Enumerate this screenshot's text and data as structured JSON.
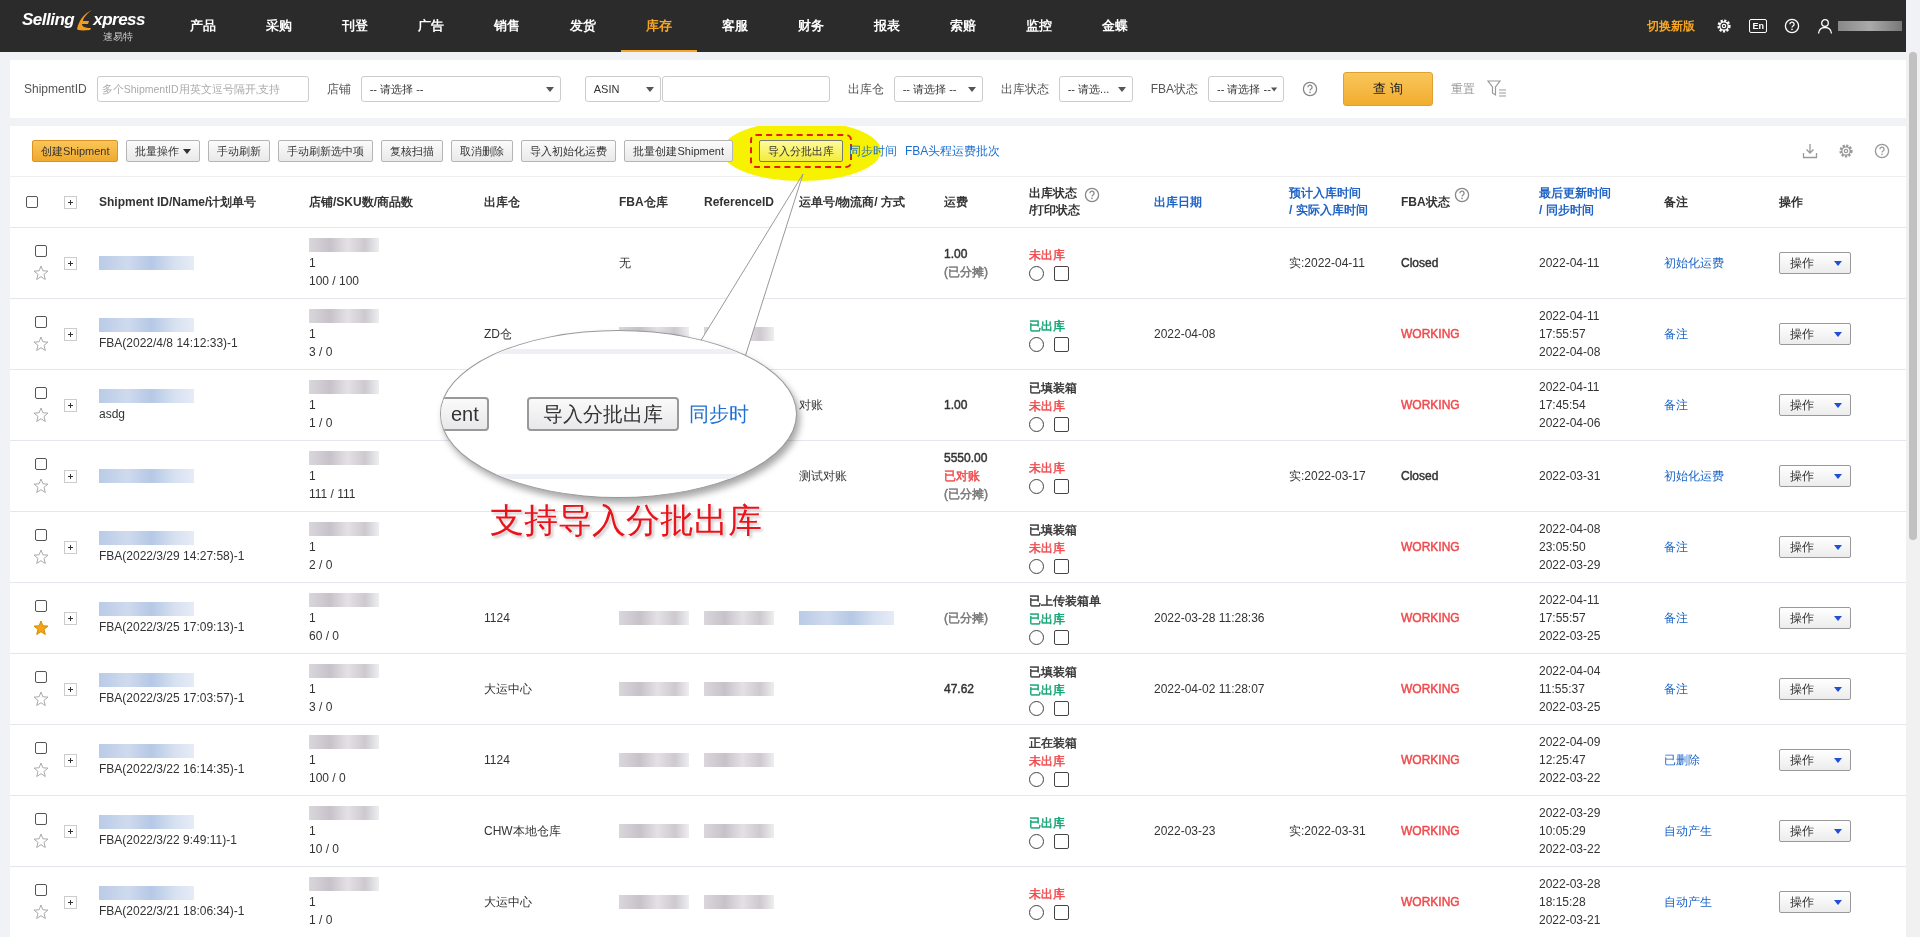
{
  "nav": {
    "logo": {
      "word1": "Selling",
      "word2": "xpress",
      "sub": "速易特"
    },
    "items": [
      {
        "label": "产品",
        "selected": false
      },
      {
        "label": "采购",
        "selected": false
      },
      {
        "label": "刊登",
        "selected": false
      },
      {
        "label": "广告",
        "selected": false
      },
      {
        "label": "销售",
        "selected": false
      },
      {
        "label": "发货",
        "selected": false
      },
      {
        "label": "库存",
        "selected": true
      },
      {
        "label": "客服",
        "selected": false
      },
      {
        "label": "财务",
        "selected": false
      },
      {
        "label": "报表",
        "selected": false
      },
      {
        "label": "索赔",
        "selected": false
      },
      {
        "label": "监控",
        "selected": false
      },
      {
        "label": "金蝶",
        "selected": false
      }
    ],
    "switch_link": "切换新版",
    "lang_button": "En"
  },
  "filters": {
    "shipment": {
      "label": "ShipmentID",
      "placeholder": "多个ShipmentID用英文逗号隔开,支持"
    },
    "shop": {
      "label": "店铺",
      "value": "-- 请选择 --"
    },
    "asin": {
      "value": "ASIN"
    },
    "warehouse": {
      "label": "出库仓",
      "value": "-- 请选择 --"
    },
    "out_status": {
      "label": "出库状态",
      "value": "-- 请选..."
    },
    "fba_status": {
      "label": "FBA状态",
      "value": "-- 请选择 --"
    },
    "search_button": "查 询",
    "reset_link": "重置"
  },
  "toolbar": {
    "buttons": [
      {
        "label": "创建Shipment",
        "kind": "primary",
        "highlighted": false
      },
      {
        "label": "批量操作",
        "kind": "dropdown",
        "highlighted": false
      },
      {
        "label": "手动刷新",
        "kind": "normal",
        "highlighted": false
      },
      {
        "label": "手动刷新选中项",
        "kind": "normal",
        "highlighted": false
      },
      {
        "label": "复核扫描",
        "kind": "normal",
        "highlighted": false
      },
      {
        "label": "取消删除",
        "kind": "normal",
        "highlighted": false
      },
      {
        "label": "导入初始化运费",
        "kind": "normal",
        "highlighted": false
      },
      {
        "label": "批量创建Shipment",
        "kind": "normal",
        "highlighted": false
      },
      {
        "label": "导入分批出库",
        "kind": "normal",
        "highlighted": true
      }
    ],
    "links": [
      "同步时间",
      "FBA头程运费批次"
    ]
  },
  "table": {
    "select_all": false,
    "columns": [
      {
        "lines": [
          "Shipment ID/Name/计划单号"
        ],
        "sortable": false,
        "help": false
      },
      {
        "lines": [
          "店铺/SKU数/商品数"
        ],
        "sortable": false,
        "help": false
      },
      {
        "lines": [
          "出库仓"
        ],
        "sortable": false,
        "help": false
      },
      {
        "lines": [
          "FBA仓库"
        ],
        "sortable": false,
        "help": false
      },
      {
        "lines": [
          "ReferenceID"
        ],
        "sortable": false,
        "help": false
      },
      {
        "lines": [
          "运单号/物流商/ 方式"
        ],
        "sortable": false,
        "help": false
      },
      {
        "lines": [
          "运费"
        ],
        "sortable": false,
        "help": false
      },
      {
        "lines": [
          "出库状态",
          "/打印状态"
        ],
        "sortable": false,
        "help": true
      },
      {
        "lines": [
          "出库日期"
        ],
        "sortable": true,
        "help": false
      },
      {
        "lines": [
          "预计入库时间",
          "/ 实际入库时间"
        ],
        "sortable": true,
        "help": false
      },
      {
        "lines": [
          "FBA状态"
        ],
        "sortable": false,
        "help": true
      },
      {
        "lines": [
          "最后更新时间",
          "/ 同步时间"
        ],
        "sortable": true,
        "help": false
      },
      {
        "lines": [
          "备注"
        ],
        "sortable": false,
        "help": false
      },
      {
        "lines": [
          "操作"
        ],
        "sortable": false,
        "help": false
      }
    ],
    "rows": [
      {
        "checked": false,
        "starred": false,
        "status_selected": false,
        "print_checked": false,
        "blurred": {
          "id": true,
          "shop": true
        },
        "id_lines": [],
        "shop_lines": [
          "1",
          "100 / 100"
        ],
        "fba_wh": "无",
        "freight": [
          {
            "text": "1.00",
            "color": "#333333"
          },
          {
            "text": "(已分摊)",
            "color": "#777777"
          }
        ],
        "status": [
          {
            "text": "未出库",
            "color": "#f0494c"
          }
        ],
        "eta": "实:2022-04-11",
        "fba": {
          "text": "Closed",
          "color": "#333333"
        },
        "updated": [
          "2022-04-11"
        ],
        "remark": "初始化运费",
        "action": "操作"
      },
      {
        "checked": false,
        "starred": false,
        "status_selected": false,
        "print_checked": false,
        "blurred": {
          "id": true,
          "shop": true,
          "fba_wh": true,
          "ref": true
        },
        "id_lines": [
          "FBA(2022/4/8 14:12:33)-1"
        ],
        "shop_lines": [
          "1",
          "3 / 0"
        ],
        "warehouse": "ZD仓",
        "status": [
          {
            "text": "已出库",
            "color": "#0fa371"
          }
        ],
        "out_date": "2022-04-08",
        "fba": {
          "text": "WORKING",
          "color": "#f0494c"
        },
        "updated": [
          "2022-04-11",
          "17:55:57",
          "2022-04-08"
        ],
        "remark": "备注",
        "action": "操作"
      },
      {
        "checked": false,
        "starred": false,
        "status_selected": false,
        "print_checked": false,
        "blurred": {
          "id": true,
          "shop": true
        },
        "id_lines": [
          "asdg"
        ],
        "shop_lines": [
          "1",
          "1 / 0"
        ],
        "carrier": "对账",
        "freight": [
          {
            "text": "1.00",
            "color": "#333333"
          }
        ],
        "status": [
          {
            "text": "已填装箱",
            "color": "#333333"
          },
          {
            "text": "未出库",
            "color": "#f0494c"
          }
        ],
        "fba": {
          "text": "WORKING",
          "color": "#f0494c"
        },
        "updated": [
          "2022-04-11",
          "17:45:54",
          "2022-04-06"
        ],
        "remark": "备注",
        "action": "操作"
      },
      {
        "checked": false,
        "starred": false,
        "status_selected": false,
        "print_checked": false,
        "blurred": {
          "id": true,
          "shop": true
        },
        "id_lines": [],
        "shop_lines": [
          "1",
          "111 / 111"
        ],
        "carrier": "测试对账",
        "freight": [
          {
            "text": "5550.00",
            "color": "#333333"
          },
          {
            "text": "已对账",
            "color": "#f0494c"
          },
          {
            "text": "(已分摊)",
            "color": "#777777"
          }
        ],
        "status": [
          {
            "text": "未出库",
            "color": "#f0494c"
          }
        ],
        "eta": "实:2022-03-17",
        "fba": {
          "text": "Closed",
          "color": "#333333"
        },
        "updated": [
          "2022-03-31"
        ],
        "remark": "初始化运费",
        "action": "操作"
      },
      {
        "checked": false,
        "starred": false,
        "status_selected": false,
        "print_checked": false,
        "blurred": {
          "id": true,
          "shop": true
        },
        "id_lines": [
          "FBA(2022/3/29 14:27:58)-1"
        ],
        "shop_lines": [
          "1",
          "2 / 0"
        ],
        "status": [
          {
            "text": "已填装箱",
            "color": "#333333"
          },
          {
            "text": "未出库",
            "color": "#f0494c"
          }
        ],
        "fba": {
          "text": "WORKING",
          "color": "#f0494c"
        },
        "updated": [
          "2022-04-08",
          "23:05:50",
          "2022-03-29"
        ],
        "remark": "备注",
        "action": "操作"
      },
      {
        "checked": false,
        "starred": true,
        "status_selected": false,
        "print_checked": false,
        "blurred": {
          "id": true,
          "shop": true,
          "fba_wh": true,
          "ref": true,
          "carrier": true
        },
        "id_lines": [
          "FBA(2022/3/25 17:09:13)-1"
        ],
        "shop_lines": [
          "1",
          "60 / 0"
        ],
        "warehouse": "1124",
        "freight": [
          {
            "text": "(已分摊)",
            "color": "#777777"
          }
        ],
        "status": [
          {
            "text": "已上传装箱单",
            "color": "#333333"
          },
          {
            "text": "已出库",
            "color": "#0fa371"
          }
        ],
        "out_date": "2022-03-28 11:28:36",
        "fba": {
          "text": "WORKING",
          "color": "#f0494c"
        },
        "updated": [
          "2022-04-11",
          "17:55:57",
          "2022-03-25"
        ],
        "remark": "备注",
        "action": "操作"
      },
      {
        "checked": false,
        "starred": false,
        "status_selected": false,
        "print_checked": false,
        "blurred": {
          "id": true,
          "shop": true,
          "fba_wh": true,
          "ref": true
        },
        "id_lines": [
          "FBA(2022/3/25 17:03:57)-1"
        ],
        "shop_lines": [
          "1",
          "3 / 0"
        ],
        "warehouse": "大运中心",
        "freight": [
          {
            "text": "47.62",
            "color": "#333333"
          }
        ],
        "status": [
          {
            "text": "已填装箱",
            "color": "#333333"
          },
          {
            "text": "已出库",
            "color": "#0fa371"
          }
        ],
        "out_date": "2022-04-02 11:28:07",
        "fba": {
          "text": "WORKING",
          "color": "#f0494c"
        },
        "updated": [
          "2022-04-04",
          "11:55:37",
          "2022-03-25"
        ],
        "remark": "备注",
        "action": "操作"
      },
      {
        "checked": false,
        "starred": false,
        "status_selected": false,
        "print_checked": false,
        "blurred": {
          "id": true,
          "shop": true,
          "fba_wh": true,
          "ref": true
        },
        "id_lines": [
          "FBA(2022/3/22 16:14:35)-1"
        ],
        "shop_lines": [
          "1",
          "100 / 0"
        ],
        "warehouse": "1124",
        "status": [
          {
            "text": "正在装箱",
            "color": "#333333"
          },
          {
            "text": "未出库",
            "color": "#f0494c"
          }
        ],
        "fba": {
          "text": "WORKING",
          "color": "#f0494c"
        },
        "updated": [
          "2022-04-09",
          "12:25:47",
          "2022-03-22"
        ],
        "remark": "已删除",
        "action": "操作"
      },
      {
        "checked": false,
        "starred": false,
        "status_selected": false,
        "print_checked": false,
        "blurred": {
          "id": true,
          "shop": true,
          "fba_wh": true,
          "ref": true
        },
        "id_lines": [
          "FBA(2022/3/22 9:49:11)-1"
        ],
        "shop_lines": [
          "1",
          "10 / 0"
        ],
        "warehouse": "CHW本地仓库",
        "status": [
          {
            "text": "已出库",
            "color": "#0fa371"
          }
        ],
        "out_date": "2022-03-23",
        "eta": "实:2022-03-31",
        "fba": {
          "text": "WORKING",
          "color": "#f0494c"
        },
        "updated": [
          "2022-03-29",
          "10:05:29",
          "2022-03-22"
        ],
        "remark": "自动产生",
        "action": "操作"
      },
      {
        "checked": false,
        "starred": false,
        "status_selected": false,
        "print_checked": false,
        "blurred": {
          "id": true,
          "shop": true,
          "fba_wh": true,
          "ref": true
        },
        "id_lines": [
          "FBA(2022/3/21 18:06:34)-1"
        ],
        "shop_lines": [
          "1",
          "1 / 0"
        ],
        "warehouse": "大运中心",
        "status": [
          {
            "text": "未出库",
            "color": "#f0494c"
          }
        ],
        "fba": {
          "text": "WORKING",
          "color": "#f0494c"
        },
        "updated": [
          "2022-03-28",
          "18:15:28",
          "2022-03-21"
        ],
        "remark": "自动产生",
        "action": "操作"
      }
    ]
  },
  "callout": {
    "zoom_partial_button": "ent",
    "zoom_button": "导入分批出库",
    "zoom_link": "同步时",
    "caption": "支持导入分批出库"
  }
}
